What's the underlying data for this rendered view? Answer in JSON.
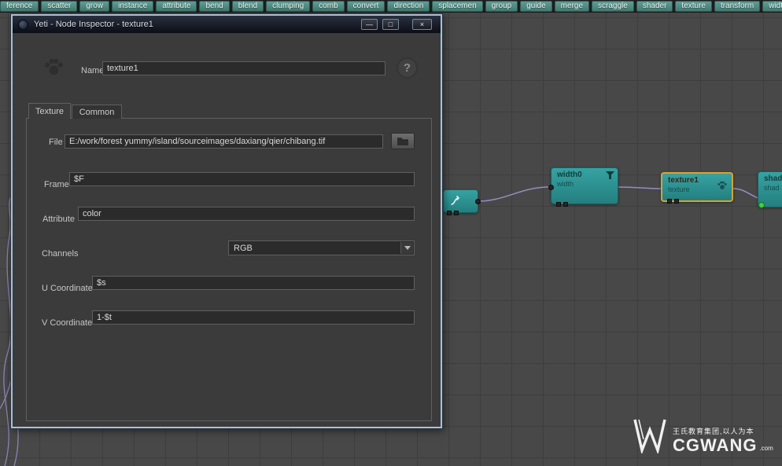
{
  "toolbar": {
    "buttons": [
      "ference",
      "scatter",
      "grow",
      "instance",
      "attribute",
      "bend",
      "blend",
      "clumping",
      "comb",
      "convert",
      "direction",
      "splacemen",
      "group",
      "guide",
      "merge",
      "scraggle",
      "shader",
      "texture",
      "transform",
      "width"
    ]
  },
  "window": {
    "title": "Yeti - Node Inspector - texture1",
    "controls": {
      "minimize": "—",
      "maximize": "□",
      "close": "×"
    },
    "help": "?",
    "name_label": "Name",
    "name_value": "texture1",
    "tabs": [
      {
        "label": "Texture"
      },
      {
        "label": "Common"
      }
    ],
    "fields": {
      "file": {
        "label": "File",
        "value": "E:/work/forest yummy/island/sourceimages/daxiang/qier/chibang.tif"
      },
      "frame": {
        "label": "Frame",
        "value": "$F"
      },
      "attribute": {
        "label": "Attribute",
        "value": "color"
      },
      "channels": {
        "label": "Channels",
        "value": "RGB"
      },
      "u": {
        "label": "U Coordinate",
        "value": "$s"
      },
      "v": {
        "label": "V Coordinate",
        "value": "1-$t"
      }
    }
  },
  "graph": {
    "nodes": {
      "width": {
        "name": "width0",
        "subtitle": "width"
      },
      "texture": {
        "name": "texture1",
        "subtitle": "texture"
      },
      "shader": {
        "name": "shad",
        "subtitle": "shad"
      }
    }
  },
  "watermark": {
    "tagline": "王氏教育集团,以人为本",
    "brand": "CGWANG",
    "domain": ".com"
  }
}
